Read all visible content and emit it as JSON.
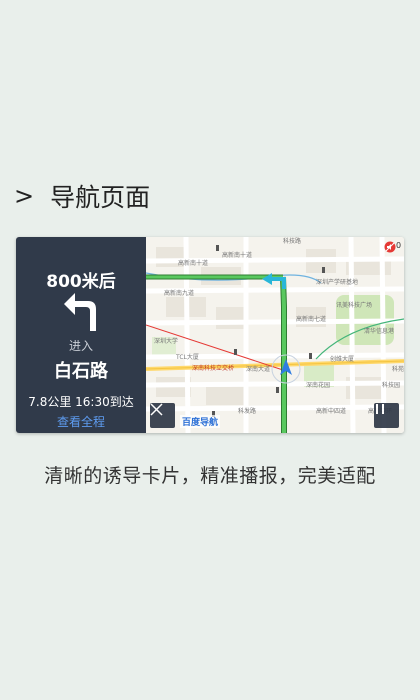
{
  "section": {
    "chevron": ">",
    "title": "导航页面"
  },
  "guide": {
    "distance": "800米后",
    "turn_icon": "turn-left-arrow-icon",
    "enter_label": "进入",
    "road_name": "白石路",
    "eta": "7.8公里 16:30到达",
    "full_route_label": "查看全程"
  },
  "map": {
    "brand": "百度导航",
    "mute_count": "0",
    "labels": [
      "高新南十道",
      "科技路",
      "高新南九道",
      "深南大道",
      "深南科技立交桥",
      "TCL大厦",
      "深圳大学",
      "高新南七道",
      "深南花园",
      "科技园",
      "科发路",
      "高新中四道",
      "创维大厦",
      "深圳产学研基地",
      "清华信息港",
      "讯美科技广场",
      "高新南环",
      "科苑路"
    ],
    "colors": {
      "route": "#4caf50",
      "route_dark": "#2e7d32",
      "panel": "#303a4a",
      "link": "#5e9cf0"
    }
  },
  "caption": "清晰的诱导卡片，精准播报，完美适配"
}
